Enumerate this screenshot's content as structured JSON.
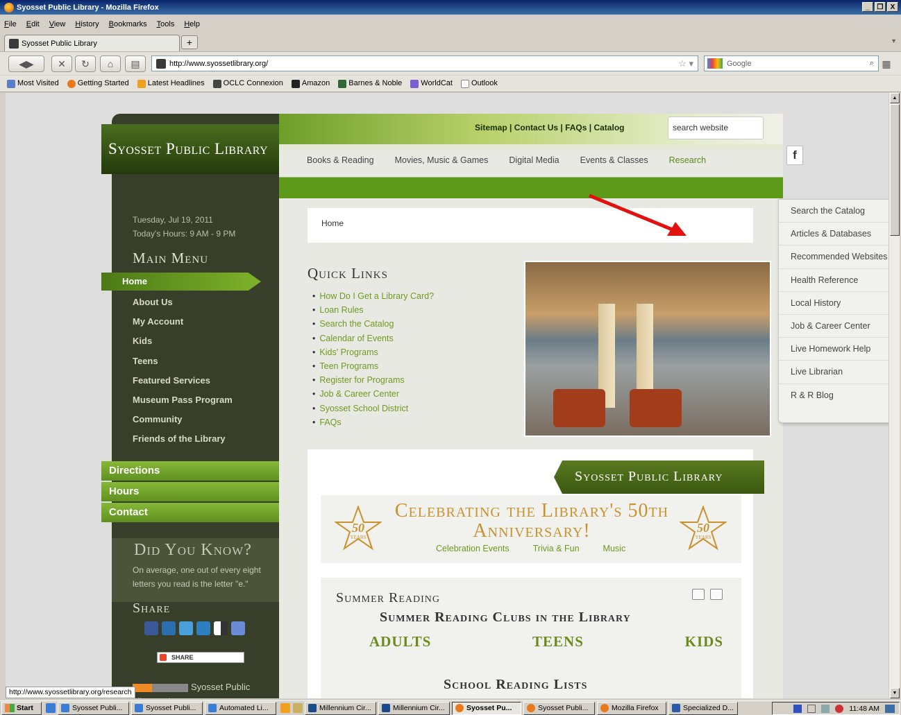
{
  "window": {
    "title": "Syosset Public Library - Mozilla Firefox",
    "controls": [
      "_",
      "❐",
      "X"
    ]
  },
  "menubar": [
    "File",
    "Edit",
    "View",
    "History",
    "Bookmarks",
    "Tools",
    "Help"
  ],
  "tab": {
    "label": "Syosset Public Library",
    "new_tab": "+"
  },
  "navbar": {
    "url": "http://www.syossetlibrary.org/",
    "search_placeholder": "Google"
  },
  "bookmarks": [
    {
      "label": "Most Visited",
      "color": "#5a7fc8"
    },
    {
      "label": "Getting Started",
      "color": "#e87a1c"
    },
    {
      "label": "Latest Headlines",
      "color": "#f0a020"
    },
    {
      "label": "OCLC Connexion",
      "color": "#444"
    },
    {
      "label": "Amazon",
      "color": "#222"
    },
    {
      "label": "Barnes & Noble",
      "color": "#2d6a3a"
    },
    {
      "label": "WorldCat",
      "color": "#7a5fd0"
    },
    {
      "label": "Outlook",
      "color": "#eee"
    }
  ],
  "site": {
    "logo": "Syosset Public Library",
    "toplinks": {
      "sitemap": "Sitemap",
      "contact": "Contact Us",
      "faqs": "FAQs",
      "catalog": "Catalog",
      "sep": " | "
    },
    "search_value": "search website",
    "mainnav": [
      "Books & Reading",
      "Movies, Music & Games",
      "Digital Media",
      "Events & Classes",
      "Research"
    ],
    "facebook": "f",
    "date": "Tuesday, Jul 19, 2011",
    "hours": "Today's Hours: 9 AM - 9 PM",
    "main_menu_title": "Main Menu",
    "home": "Home",
    "menu": [
      "About Us",
      "My Account",
      "Kids",
      "Teens",
      "Featured Services",
      "Museum Pass Program",
      "Community",
      "Friends of the Library"
    ],
    "green_buttons": [
      "Directions",
      "Hours",
      "Contact"
    ],
    "did_you_know": {
      "title": "Did You Know?",
      "text": "On average, one out of every eight letters you read is the letter \"e.\""
    },
    "share_title": "Share",
    "share_button": "SHARE",
    "social_colors": [
      "#3b5998",
      "#2a6fb0",
      "#4aa0d8",
      "#2e7fc0",
      "#333",
      "#6a8cd8"
    ],
    "rss_text": "Syosset Public Library Site",
    "breadcrumb": "Home",
    "quick_links_title": "Quick Links",
    "quick_links": [
      "How Do I Get a Library Card?",
      "Loan Rules",
      "Search the Catalog",
      "Calendar of Events",
      "Kids' Programs",
      "Teen Programs",
      "Register for Programs",
      "Job & Career Center",
      "Syosset School District",
      "FAQs"
    ],
    "banner": "Syosset Public Library",
    "anniversary": {
      "title": "Celebrating the Library's 50th Anniversary!",
      "links": [
        "Celebration Events",
        "Trivia & Fun",
        "Music"
      ],
      "badge_number": "50",
      "badge_text": "YEARS"
    },
    "summer": {
      "title": "Summer Reading",
      "subtitle": "Summer Reading Clubs in the Library",
      "categories": [
        "ADULTS",
        "TEENS",
        "KIDS"
      ],
      "lists": "School Reading Lists"
    },
    "research_dropdown": [
      "Search the Catalog",
      "Articles & Databases",
      "Recommended Websites",
      "Health Reference",
      "Local History",
      "Job & Career Center",
      "Live Homework Help",
      "Live Librarian",
      "R & R Blog"
    ]
  },
  "status_url": "http://www.syossetlibrary.org/research",
  "taskbar": {
    "start": "Start",
    "items": [
      {
        "label": "Syosset Publi...",
        "color": "#3a7bd5",
        "active": false
      },
      {
        "label": "Syosset Publi...",
        "color": "#3a7bd5",
        "active": false
      },
      {
        "label": "Automated Li...",
        "color": "#3a7bd5",
        "active": false
      },
      {
        "label": "Millennium Cir...",
        "color": "#1a4a8a",
        "active": false
      },
      {
        "label": "Millennium Cir...",
        "color": "#1a4a8a",
        "active": false
      },
      {
        "label": "Syosset Pu...",
        "color": "#e87a1c",
        "active": true
      },
      {
        "label": "Syosset Publi...",
        "color": "#e87a1c",
        "active": false
      },
      {
        "label": "Mozilla Firefox",
        "color": "#e87a1c",
        "active": false
      },
      {
        "label": "Specialized D...",
        "color": "#2a5aa8",
        "active": false
      }
    ],
    "clock": "11:48 AM"
  }
}
